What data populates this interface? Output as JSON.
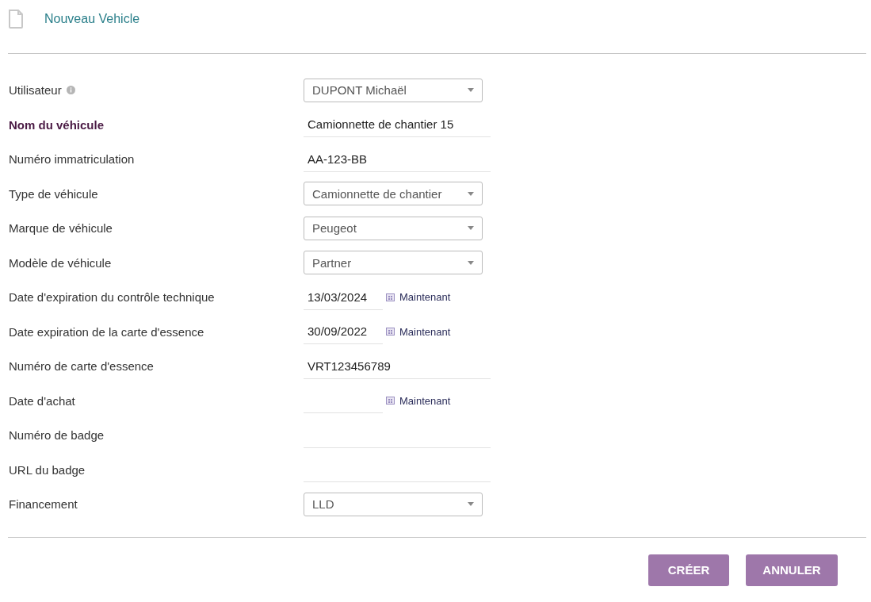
{
  "title": "Nouveau Vehicle",
  "fields": [
    {
      "label": "Utilisateur",
      "info": true,
      "required": false,
      "kind": "select",
      "value": "DUPONT Michaël"
    },
    {
      "label": "Nom du véhicule",
      "info": false,
      "required": true,
      "kind": "text",
      "value": "Camionnette de chantier 15"
    },
    {
      "label": "Numéro immatriculation",
      "info": false,
      "required": false,
      "kind": "text",
      "value": "AA-123-BB"
    },
    {
      "label": "Type de véhicule",
      "info": false,
      "required": false,
      "kind": "select",
      "value": "Camionnette de chantier"
    },
    {
      "label": "Marque de véhicule",
      "info": false,
      "required": false,
      "kind": "select",
      "value": "Peugeot"
    },
    {
      "label": "Modèle de véhicule",
      "info": false,
      "required": false,
      "kind": "select",
      "value": "Partner"
    },
    {
      "label": "Date d'expiration du contrôle technique",
      "info": false,
      "required": false,
      "kind": "date",
      "value": "13/03/2024",
      "now_link": "Maintenant"
    },
    {
      "label": "Date expiration de la carte d'essence",
      "info": false,
      "required": false,
      "kind": "date",
      "value": "30/09/2022",
      "now_link": "Maintenant"
    },
    {
      "label": "Numéro de carte d'essence",
      "info": false,
      "required": false,
      "kind": "text",
      "value": "VRT123456789"
    },
    {
      "label": "Date d'achat",
      "info": false,
      "required": false,
      "kind": "date",
      "now_link": "Maintenant"
    },
    {
      "label": "Numéro de badge",
      "info": false,
      "required": false,
      "kind": "text"
    },
    {
      "label": "URL du badge",
      "info": false,
      "required": false,
      "kind": "text"
    },
    {
      "label": "Financement",
      "info": false,
      "required": false,
      "kind": "select",
      "value": "LLD"
    }
  ],
  "buttons": [
    "CRÉER",
    "ANNULER"
  ]
}
